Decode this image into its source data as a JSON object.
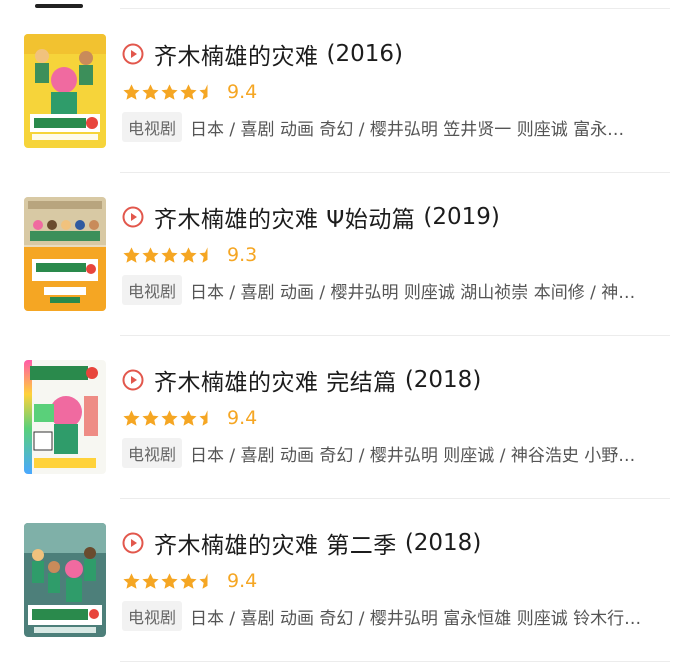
{
  "items": [
    {
      "title": "齐木楠雄的灾难",
      "year": "(2016)",
      "rating": 4.5,
      "score": "9.4",
      "badge": "电视剧",
      "meta": "日本 / 喜剧 动画 奇幻 / 樱井弘明 笠井贤一 则座诚 富永…"
    },
    {
      "title": "齐木楠雄的灾难 Ψ始动篇",
      "year": "(2019)",
      "rating": 4.5,
      "score": "9.3",
      "badge": "电视剧",
      "meta": "日本 / 喜剧 动画 / 樱井弘明 则座诚 湖山祯崇 本间修 / 神…"
    },
    {
      "title": "齐木楠雄的灾难 完结篇",
      "year": "(2018)",
      "rating": 4.5,
      "score": "9.4",
      "badge": "电视剧",
      "meta": "日本 / 喜剧 动画 奇幻 / 樱井弘明 则座诚 / 神谷浩史 小野…"
    },
    {
      "title": "齐木楠雄的灾难 第二季",
      "year": "(2018)",
      "rating": 4.5,
      "score": "9.4",
      "badge": "电视剧",
      "meta": "日本 / 喜剧 动画 奇幻 / 樱井弘明 富永恒雄 则座诚 铃木行…"
    }
  ],
  "colors": {
    "accent": "#e2574c",
    "star": "#f5a623",
    "badge_bg": "#f2f2f2"
  },
  "icons": {
    "play": "play-circle-icon",
    "star": "star-icon"
  }
}
